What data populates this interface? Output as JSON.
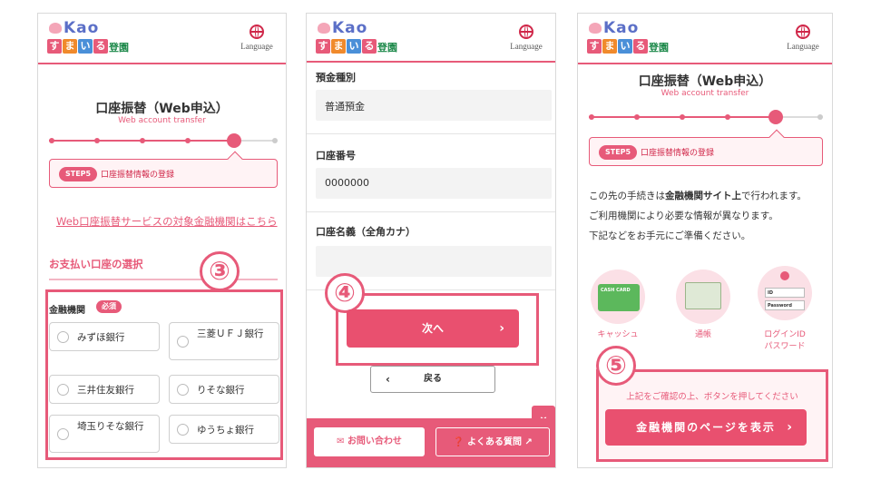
{
  "brand": {
    "kao": "Kao",
    "blocks": [
      "す",
      "ま",
      "い",
      "る"
    ],
    "tail": "登園",
    "language_label": "Language"
  },
  "step_badge": "STEP5",
  "step_text": "口座振替情報の登録",
  "panel1": {
    "title": "口座振替（Web申込）",
    "subtitle": "Web account transfer",
    "link": "Web口座振替サービスの対象金融機関はこちら",
    "section_heading": "お支払い口座の選択",
    "field_label": "金融機関",
    "required": "必須",
    "banks": [
      "みずほ銀行",
      "三菱ＵＦＪ銀行",
      "三井住友銀行",
      "りそな銀行",
      "埼玉りそな銀行",
      "ゆうちょ銀行"
    ],
    "marker": "③"
  },
  "panel2": {
    "deposit_type_label": "預金種別",
    "deposit_type_value": "普通預金",
    "account_number_label": "口座番号",
    "account_number_value": "0000000",
    "account_name_label": "口座名義（全角カナ）",
    "account_name_value": "",
    "next_label": "次へ",
    "back_label": "戻る",
    "contact_label": "お問い合わせ",
    "faq_label": "よくある質問",
    "marker": "④"
  },
  "panel3": {
    "title": "口座振替（Web申込）",
    "subtitle": "Web account transfer",
    "body_pre": "この先の手続きは",
    "body_bold": "金融機関サイト上",
    "body_post": "で行われます。",
    "body_line2": "ご利用機関により必要な情報が異なります。",
    "body_line3": "下記などをお手元にご準備ください。",
    "card_text": "CASH CARD",
    "id_text": "ID",
    "password_text": "Password",
    "items": [
      "キャッシュ",
      "通帳",
      "ログインID",
      "パスワード"
    ],
    "confirm_text": "上記をご確認の上、ボタンを押してください",
    "button_label": "金融機関のページを表示",
    "marker": "⑤"
  },
  "colors": {
    "accent": "#e75a79",
    "accent_dark": "#d0284a",
    "field_bg": "#f3f3f3"
  }
}
